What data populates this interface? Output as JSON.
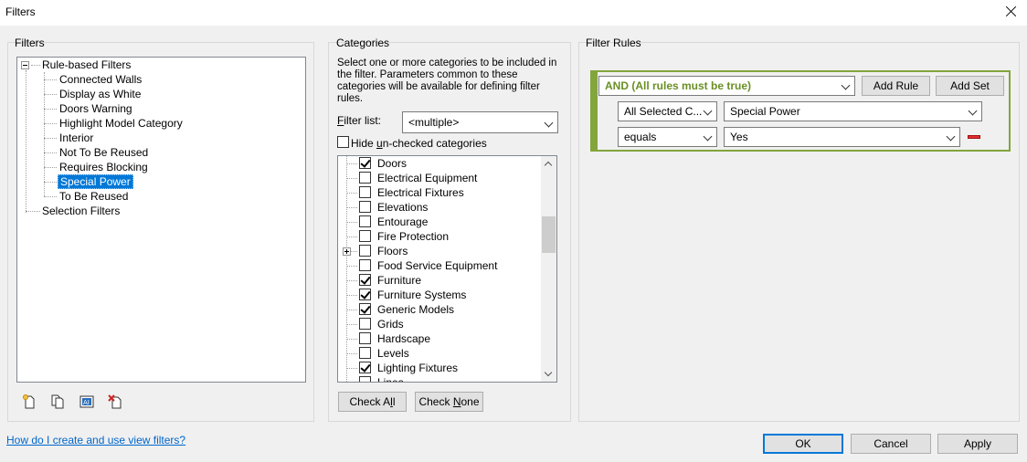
{
  "window": {
    "title": "Filters"
  },
  "filters_panel": {
    "label": "Filters",
    "tree": {
      "root": "Rule-based Filters",
      "items": [
        "Connected Walls",
        "Display as White",
        "Doors Warning",
        "Highlight Model Category",
        "Interior",
        "Not To Be Reused",
        "Requires Blocking",
        "Special Power",
        "To Be Reused"
      ],
      "selected": "Special Power",
      "selection_root": "Selection Filters"
    },
    "tool_icons": [
      "new-filter-icon",
      "duplicate-filter-icon",
      "rename-filter-icon",
      "delete-filter-icon"
    ]
  },
  "categories_panel": {
    "label": "Categories",
    "description": "Select one or more categories to be included in the filter.  Parameters common to these categories will be available for defining filter rules.",
    "filter_list_label": "Filter list:",
    "filter_list_value": "<multiple>",
    "hide_unchecked_label": "Hide un-checked categories",
    "categories": [
      {
        "name": "Doors",
        "checked": true
      },
      {
        "name": "Electrical Equipment",
        "checked": false
      },
      {
        "name": "Electrical Fixtures",
        "checked": false
      },
      {
        "name": "Elevations",
        "checked": false
      },
      {
        "name": "Entourage",
        "checked": false
      },
      {
        "name": "Fire Protection",
        "checked": false
      },
      {
        "name": "Floors",
        "checked": false,
        "expandable": true
      },
      {
        "name": "Food Service Equipment",
        "checked": false
      },
      {
        "name": "Furniture",
        "checked": true
      },
      {
        "name": "Furniture Systems",
        "checked": true
      },
      {
        "name": "Generic Models",
        "checked": true
      },
      {
        "name": "Grids",
        "checked": false
      },
      {
        "name": "Hardscape",
        "checked": false
      },
      {
        "name": "Levels",
        "checked": false
      },
      {
        "name": "Lighting Fixtures",
        "checked": true
      },
      {
        "name": "Lines",
        "checked": false
      }
    ],
    "check_all": "Check All",
    "check_none": "Check None"
  },
  "rules_panel": {
    "label": "Filter Rules",
    "logic": "AND (All rules must be true)",
    "add_rule": "Add Rule",
    "add_set": "Add Set",
    "parameter_category": "All Selected C...",
    "parameter": "Special Power",
    "operator": "equals",
    "value": "Yes"
  },
  "footer": {
    "help_link": "How do I create and use view filters?",
    "ok": "OK",
    "cancel": "Cancel",
    "apply": "Apply"
  },
  "colors": {
    "rules_border": "#82a53c",
    "selection": "#0078d7",
    "link": "#0066cc",
    "remove": "#e03030"
  }
}
